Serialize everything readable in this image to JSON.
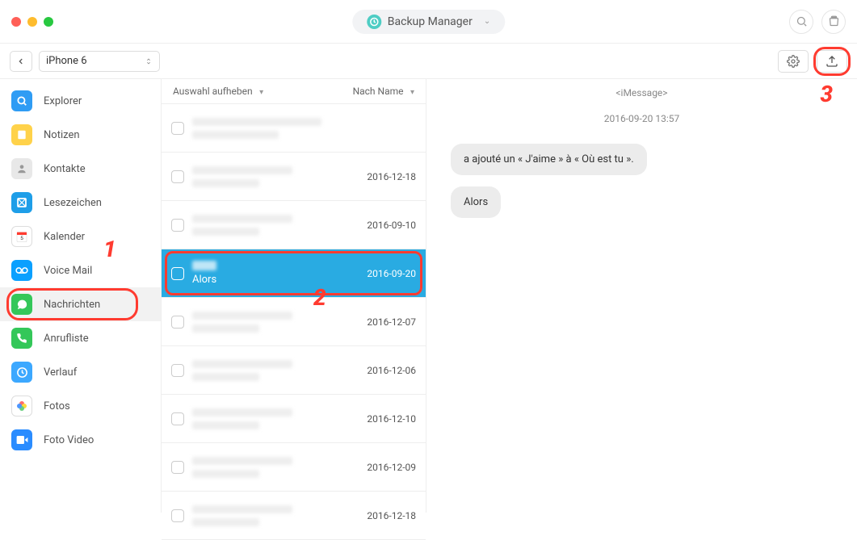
{
  "header": {
    "mode_label": "Backup Manager"
  },
  "toolbar": {
    "device_label": "iPhone 6"
  },
  "sidebar": {
    "items": [
      {
        "label": "Explorer",
        "icon": "search-icon",
        "bg": "#2f9cf4"
      },
      {
        "label": "Notizen",
        "icon": "note-icon",
        "bg": "#ffd24a"
      },
      {
        "label": "Kontakte",
        "icon": "contacts-icon",
        "bg": "#e8e8e8"
      },
      {
        "label": "Lesezeichen",
        "icon": "bookmark-icon",
        "bg": "#1e9ee8"
      },
      {
        "label": "Kalender",
        "icon": "calendar-icon",
        "bg": "#ffffff"
      },
      {
        "label": "Voice Mail",
        "icon": "voicemail-icon",
        "bg": "#0aa0ff"
      },
      {
        "label": "Nachrichten",
        "icon": "messages-icon",
        "bg": "#34c759"
      },
      {
        "label": "Anrufliste",
        "icon": "phone-icon",
        "bg": "#34c759"
      },
      {
        "label": "Verlauf",
        "icon": "history-icon",
        "bg": "#3ca8ff"
      },
      {
        "label": "Fotos",
        "icon": "photos-icon",
        "bg": "#ffffff"
      },
      {
        "label": "Foto Video",
        "icon": "video-icon",
        "bg": "#2a8cff"
      }
    ],
    "active_index": 6
  },
  "msglist": {
    "head_left": "Auswahl aufheben",
    "head_right": "Nach Name",
    "rows": [
      {
        "date": ""
      },
      {
        "date": "2016-12-18"
      },
      {
        "date": "2016-09-10"
      },
      {
        "date": "2016-09-20",
        "selected": true,
        "preview": "Alors"
      },
      {
        "date": "2016-12-07"
      },
      {
        "date": "2016-12-06"
      },
      {
        "date": "2016-12-10"
      },
      {
        "date": "2016-12-09"
      },
      {
        "date": "2016-12-18"
      }
    ]
  },
  "detail": {
    "source": "<iMessage>",
    "timestamp": "2016-09-20 13:57",
    "bubbles": [
      "a ajouté un « J'aime » à « Où est tu  ».",
      "Alors"
    ]
  },
  "annotations": {
    "a1": "1",
    "a2": "2",
    "a3": "3"
  }
}
